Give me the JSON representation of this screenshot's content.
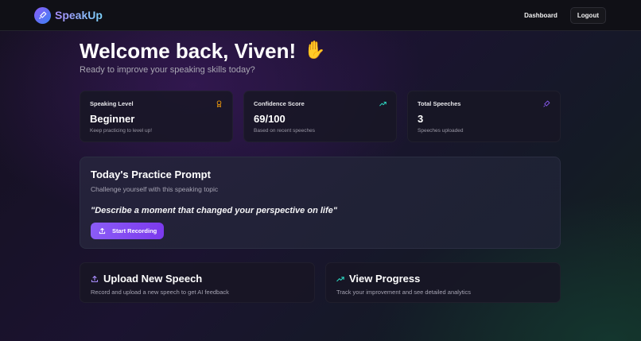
{
  "nav": {
    "brand": "SpeakUp",
    "dashboard_label": "Dashboard",
    "logout_label": "Logout"
  },
  "welcome": {
    "title": "Welcome back, Viven!",
    "subtitle": "Ready to improve your speaking skills today?"
  },
  "stats": [
    {
      "label": "Speaking Level",
      "value": "Beginner",
      "note": "Keep practicing to level up!",
      "icon": "award-icon",
      "icon_color": "#f59e0b"
    },
    {
      "label": "Confidence Score",
      "value": "69/100",
      "note": "Based on recent speeches",
      "icon": "trending-up-icon",
      "icon_color": "#2dd4bf"
    },
    {
      "label": "Total Speeches",
      "value": "3",
      "note": "Speeches uploaded",
      "icon": "mic-icon",
      "icon_color": "#8b5cf6"
    }
  ],
  "prompt": {
    "title": "Today's Practice Prompt",
    "subtitle": "Challenge yourself with this speaking topic",
    "quote": "\"Describe a moment that changed your perspective on life\"",
    "button_label": "Start Recording"
  },
  "actions": [
    {
      "title": "Upload New Speech",
      "description": "Record and upload a new speech to get AI feedback",
      "icon": "upload-icon",
      "icon_color": "#a78bfa"
    },
    {
      "title": "View Progress",
      "description": "Track your improvement and see detailed analytics",
      "icon": "trending-up-icon",
      "icon_color": "#2dd4bf"
    }
  ],
  "colors": {
    "accent": "#8b5cf6",
    "background": "#15121f"
  }
}
